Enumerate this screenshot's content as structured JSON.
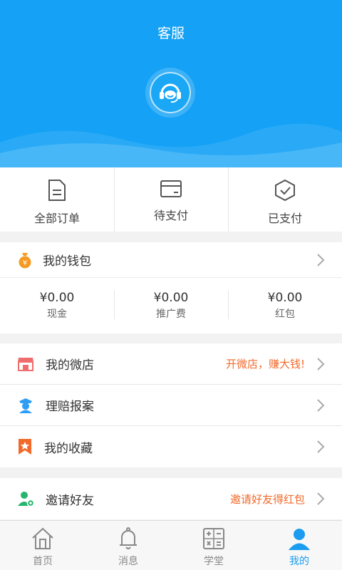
{
  "header": {
    "title": "客服"
  },
  "orders": [
    {
      "label": "全部订单",
      "icon": "document-icon"
    },
    {
      "label": "待支付",
      "icon": "card-icon"
    },
    {
      "label": "已支付",
      "icon": "check-shield-icon"
    }
  ],
  "wallet": {
    "title": "我的钱包",
    "values": [
      {
        "amount": "¥0.00",
        "caption": "现金"
      },
      {
        "amount": "¥0.00",
        "caption": "推广费"
      },
      {
        "amount": "¥0.00",
        "caption": "红包"
      }
    ]
  },
  "menu": {
    "shop": {
      "label": "我的微店",
      "hint": "开微店，赚大钱!"
    },
    "claim": {
      "label": "理赔报案"
    },
    "favorite": {
      "label": "我的收藏"
    },
    "invite": {
      "label": "邀请好友",
      "hint": "邀请好友得红包"
    }
  },
  "tabs": [
    {
      "label": "首页"
    },
    {
      "label": "消息"
    },
    {
      "label": "学堂"
    },
    {
      "label": "我的",
      "active": true
    }
  ],
  "colors": {
    "primary": "#14a1f6",
    "accent": "#f26a2b",
    "active_tab": "#1a9df0"
  }
}
